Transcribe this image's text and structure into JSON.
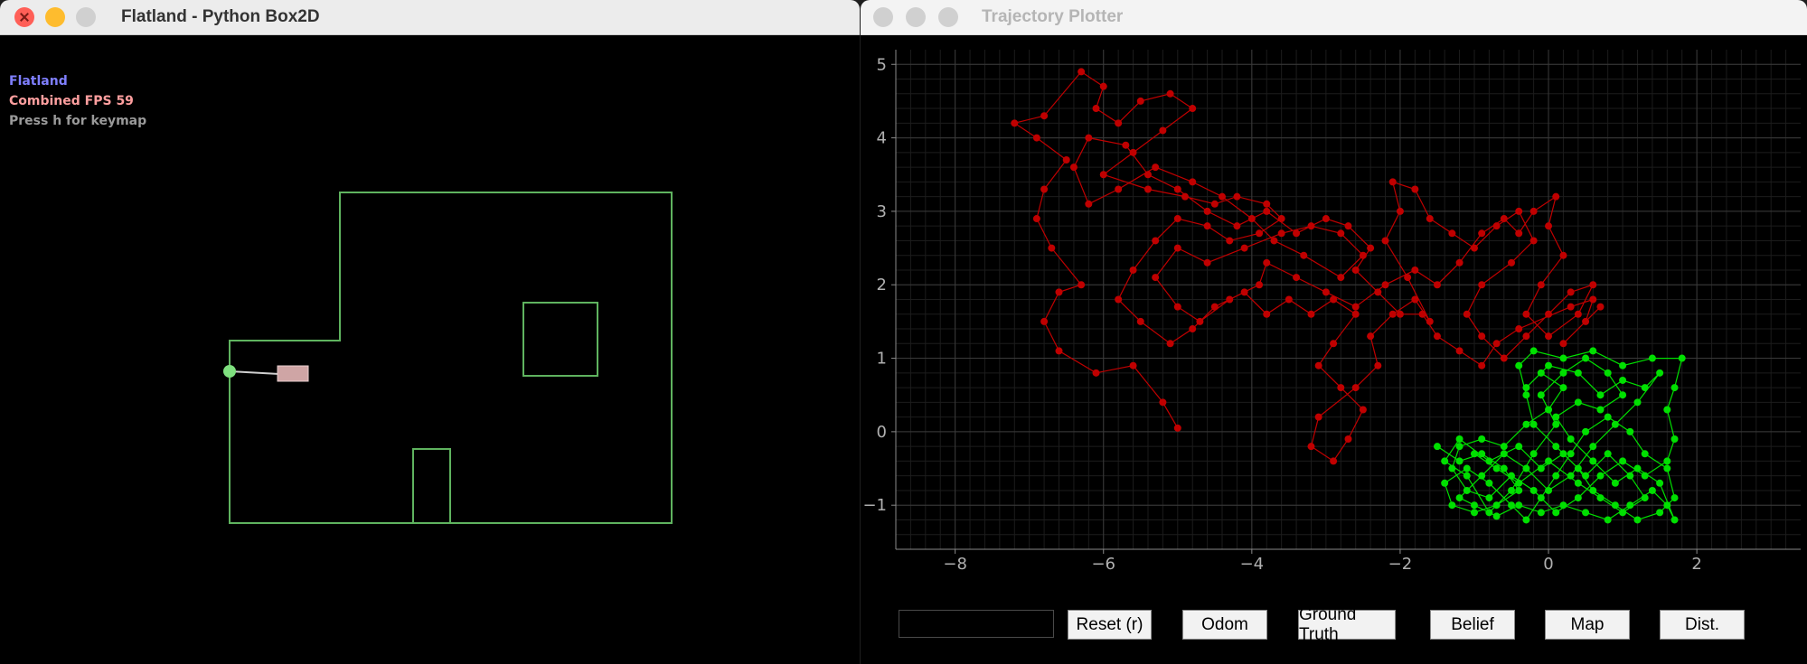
{
  "left_window": {
    "title": "Flatland - Python Box2D",
    "overlay": {
      "line1": "Flatland",
      "line2": "Combined FPS 59",
      "line3": "Press h for keymap"
    },
    "colors": {
      "walls": "#5fb35f",
      "robot_body": "#cfa5a5",
      "sensor_dot": "#7fe07f",
      "line1": "#7f7fff",
      "line2": "#ff9f9f",
      "line3": "#9a9a9a"
    }
  },
  "right_window": {
    "title": "Trajectory Plotter",
    "text_input_value": "",
    "buttons": {
      "reset": "Reset (r)",
      "odom": "Odom",
      "ground_truth": "Ground Truth",
      "belief": "Belief",
      "map": "Map",
      "dist": "Dist."
    }
  },
  "chart_data": {
    "type": "scatter",
    "xlim": [
      -8.8,
      3.4
    ],
    "ylim": [
      -1.6,
      5.2
    ],
    "x_ticks": [
      -8,
      -6,
      -4,
      -2,
      0,
      2
    ],
    "y_ticks": [
      -1,
      0,
      1,
      2,
      3,
      4,
      5
    ],
    "grid": true,
    "series": [
      {
        "color": "#c00000",
        "style": "line+markers",
        "points": [
          [
            -5.0,
            0.05
          ],
          [
            -5.2,
            0.4
          ],
          [
            -5.6,
            0.9
          ],
          [
            -6.1,
            0.8
          ],
          [
            -6.6,
            1.1
          ],
          [
            -6.8,
            1.5
          ],
          [
            -6.6,
            1.9
          ],
          [
            -6.3,
            2.0
          ],
          [
            -6.7,
            2.5
          ],
          [
            -6.9,
            2.9
          ],
          [
            -6.8,
            3.3
          ],
          [
            -6.5,
            3.7
          ],
          [
            -6.9,
            4.0
          ],
          [
            -7.2,
            4.2
          ],
          [
            -6.8,
            4.3
          ],
          [
            -6.3,
            4.9
          ],
          [
            -6.0,
            4.7
          ],
          [
            -6.1,
            4.4
          ],
          [
            -5.8,
            4.2
          ],
          [
            -5.5,
            4.5
          ],
          [
            -5.1,
            4.6
          ],
          [
            -4.8,
            4.4
          ],
          [
            -5.2,
            4.1
          ],
          [
            -5.6,
            3.8
          ],
          [
            -6.0,
            3.5
          ],
          [
            -5.4,
            3.3
          ],
          [
            -4.9,
            3.2
          ],
          [
            -4.5,
            3.1
          ],
          [
            -4.2,
            3.2
          ],
          [
            -3.8,
            3.1
          ],
          [
            -3.6,
            2.9
          ],
          [
            -3.9,
            2.7
          ],
          [
            -4.3,
            2.6
          ],
          [
            -4.6,
            2.8
          ],
          [
            -5.0,
            2.9
          ],
          [
            -5.3,
            2.6
          ],
          [
            -5.6,
            2.2
          ],
          [
            -5.8,
            1.8
          ],
          [
            -5.5,
            1.5
          ],
          [
            -5.1,
            1.2
          ],
          [
            -4.8,
            1.4
          ],
          [
            -4.5,
            1.7
          ],
          [
            -4.1,
            1.9
          ],
          [
            -3.8,
            1.6
          ],
          [
            -3.5,
            1.8
          ],
          [
            -3.2,
            1.6
          ],
          [
            -2.9,
            1.8
          ],
          [
            -2.6,
            1.6
          ],
          [
            -2.9,
            1.2
          ],
          [
            -3.1,
            0.9
          ],
          [
            -2.8,
            0.6
          ],
          [
            -2.5,
            0.3
          ],
          [
            -2.7,
            -0.1
          ],
          [
            -2.9,
            -0.4
          ],
          [
            -3.2,
            -0.2
          ],
          [
            -3.1,
            0.2
          ],
          [
            -2.6,
            0.6
          ],
          [
            -2.3,
            0.9
          ],
          [
            -2.4,
            1.3
          ],
          [
            -2.1,
            1.6
          ],
          [
            -1.8,
            1.8
          ],
          [
            -1.6,
            1.5
          ],
          [
            -1.9,
            2.1
          ],
          [
            -2.2,
            2.6
          ],
          [
            -2.0,
            3.0
          ],
          [
            -2.1,
            3.4
          ],
          [
            -1.8,
            3.3
          ],
          [
            -1.6,
            2.9
          ],
          [
            -1.3,
            2.7
          ],
          [
            -1.0,
            2.5
          ],
          [
            -0.7,
            2.8
          ],
          [
            -0.4,
            3.0
          ],
          [
            -0.2,
            2.6
          ],
          [
            -0.5,
            2.3
          ],
          [
            -0.9,
            2.0
          ],
          [
            -1.1,
            1.6
          ],
          [
            -0.9,
            1.3
          ],
          [
            -0.6,
            1.0
          ],
          [
            -0.3,
            1.3
          ],
          [
            0.0,
            1.6
          ],
          [
            0.3,
            1.9
          ],
          [
            0.6,
            2.0
          ],
          [
            0.4,
            1.6
          ],
          [
            0.0,
            1.3
          ],
          [
            -0.3,
            1.6
          ],
          [
            -0.1,
            2.0
          ],
          [
            0.2,
            2.4
          ],
          [
            0.0,
            2.8
          ],
          [
            0.1,
            3.2
          ],
          [
            -0.2,
            3.0
          ],
          [
            -0.4,
            2.7
          ],
          [
            -0.6,
            2.9
          ],
          [
            -0.9,
            2.7
          ],
          [
            -1.2,
            2.3
          ],
          [
            -1.5,
            2.0
          ],
          [
            -1.8,
            2.2
          ],
          [
            -2.2,
            2.0
          ],
          [
            -2.6,
            1.7
          ],
          [
            -3.0,
            1.9
          ],
          [
            -3.4,
            2.1
          ],
          [
            -3.8,
            2.3
          ],
          [
            -3.9,
            2.0
          ],
          [
            -4.3,
            1.8
          ],
          [
            -4.7,
            1.5
          ],
          [
            -5.0,
            1.7
          ],
          [
            -5.3,
            2.1
          ],
          [
            -5.0,
            2.5
          ],
          [
            -4.6,
            2.3
          ],
          [
            -4.1,
            2.5
          ],
          [
            -3.6,
            2.7
          ],
          [
            -3.2,
            2.8
          ],
          [
            -2.8,
            2.7
          ],
          [
            -2.5,
            2.4
          ],
          [
            -2.8,
            2.1
          ],
          [
            -3.3,
            2.4
          ],
          [
            -3.7,
            2.6
          ],
          [
            -4.0,
            2.9
          ],
          [
            -4.4,
            3.2
          ],
          [
            -4.8,
            3.4
          ],
          [
            -5.3,
            3.6
          ],
          [
            -5.8,
            3.3
          ],
          [
            -6.2,
            3.1
          ],
          [
            -6.4,
            3.6
          ],
          [
            -6.2,
            4.0
          ],
          [
            -5.7,
            3.9
          ],
          [
            -5.4,
            3.5
          ],
          [
            -5.0,
            3.3
          ],
          [
            -4.6,
            3.0
          ],
          [
            -4.2,
            2.8
          ],
          [
            -3.8,
            3.0
          ],
          [
            -3.4,
            2.7
          ],
          [
            -3.0,
            2.9
          ],
          [
            -2.7,
            2.8
          ],
          [
            -2.4,
            2.5
          ],
          [
            -2.6,
            2.2
          ],
          [
            -2.3,
            1.9
          ],
          [
            -2.0,
            1.6
          ],
          [
            -1.7,
            1.6
          ],
          [
            -1.5,
            1.3
          ],
          [
            -1.2,
            1.1
          ],
          [
            -0.9,
            0.9
          ],
          [
            -0.7,
            1.2
          ],
          [
            -0.4,
            1.4
          ],
          [
            0.3,
            1.7
          ],
          [
            0.6,
            1.8
          ],
          [
            0.5,
            1.5
          ],
          [
            0.7,
            1.7
          ],
          [
            0.2,
            1.2
          ]
        ]
      },
      {
        "color": "#00e000",
        "style": "line+markers",
        "points": [
          [
            -1.5,
            -0.2
          ],
          [
            -1.2,
            -0.4
          ],
          [
            -0.9,
            -0.3
          ],
          [
            -0.6,
            -0.5
          ],
          [
            -0.4,
            -0.8
          ],
          [
            -0.7,
            -1.0
          ],
          [
            -1.0,
            -1.1
          ],
          [
            -1.3,
            -1.0
          ],
          [
            -1.4,
            -0.7
          ],
          [
            -1.1,
            -0.5
          ],
          [
            -0.8,
            -0.7
          ],
          [
            -0.5,
            -1.0
          ],
          [
            -0.3,
            -1.2
          ],
          [
            -0.1,
            -0.9
          ],
          [
            0.1,
            -0.6
          ],
          [
            0.3,
            -0.3
          ],
          [
            0.5,
            0.0
          ],
          [
            0.8,
            0.2
          ],
          [
            1.1,
            0.0
          ],
          [
            1.3,
            -0.3
          ],
          [
            1.6,
            -0.5
          ],
          [
            1.7,
            -0.9
          ],
          [
            1.5,
            -1.1
          ],
          [
            1.2,
            -1.2
          ],
          [
            0.9,
            -1.0
          ],
          [
            0.6,
            -0.8
          ],
          [
            0.4,
            -0.5
          ],
          [
            0.1,
            -0.2
          ],
          [
            -0.2,
            0.1
          ],
          [
            -0.3,
            0.5
          ],
          [
            -0.4,
            0.9
          ],
          [
            -0.2,
            1.1
          ],
          [
            0.2,
            1.0
          ],
          [
            0.6,
            1.1
          ],
          [
            1.0,
            0.9
          ],
          [
            1.4,
            1.0
          ],
          [
            1.8,
            1.0
          ],
          [
            1.7,
            0.6
          ],
          [
            1.6,
            0.3
          ],
          [
            1.7,
            -0.1
          ],
          [
            1.6,
            -0.4
          ],
          [
            1.3,
            -0.6
          ],
          [
            1.0,
            -0.4
          ],
          [
            0.7,
            -0.6
          ],
          [
            0.4,
            -0.9
          ],
          [
            0.1,
            -1.1
          ],
          [
            -0.2,
            -0.8
          ],
          [
            -0.5,
            -0.6
          ],
          [
            -0.8,
            -0.9
          ],
          [
            -1.1,
            -0.8
          ],
          [
            -1.3,
            -0.5
          ],
          [
            -1.2,
            -0.2
          ],
          [
            -0.9,
            -0.1
          ],
          [
            -0.6,
            -0.2
          ],
          [
            -0.3,
            0.1
          ],
          [
            0.0,
            0.3
          ],
          [
            0.2,
            0.6
          ],
          [
            -0.1,
            0.8
          ],
          [
            -0.3,
            0.6
          ],
          [
            0.0,
            0.9
          ],
          [
            0.4,
            0.8
          ],
          [
            0.7,
            0.5
          ],
          [
            1.0,
            0.7
          ],
          [
            1.3,
            0.6
          ],
          [
            1.5,
            0.8
          ],
          [
            1.2,
            0.4
          ],
          [
            0.9,
            0.1
          ],
          [
            0.6,
            -0.2
          ],
          [
            0.3,
            -0.6
          ],
          [
            0.0,
            -0.8
          ],
          [
            -0.3,
            -0.5
          ],
          [
            -0.6,
            -0.3
          ],
          [
            -0.9,
            -0.6
          ],
          [
            -1.2,
            -0.9
          ],
          [
            -1.0,
            -1.0
          ],
          [
            -0.7,
            -1.15
          ],
          [
            -0.4,
            -1.0
          ],
          [
            -0.1,
            -1.1
          ],
          [
            0.2,
            -1.0
          ],
          [
            0.5,
            -1.1
          ],
          [
            0.8,
            -1.2
          ],
          [
            1.1,
            -1.0
          ],
          [
            1.4,
            -0.8
          ],
          [
            1.6,
            -1.0
          ],
          [
            1.7,
            -1.2
          ],
          [
            1.5,
            -0.7
          ],
          [
            1.2,
            -0.5
          ],
          [
            0.9,
            -0.7
          ],
          [
            0.6,
            -0.4
          ],
          [
            0.3,
            -0.1
          ],
          [
            0.1,
            0.2
          ],
          [
            0.4,
            0.4
          ],
          [
            0.7,
            0.3
          ],
          [
            1.0,
            0.5
          ],
          [
            0.8,
            0.8
          ],
          [
            0.5,
            1.0
          ],
          [
            0.2,
            0.8
          ],
          [
            -0.1,
            0.5
          ],
          [
            0.1,
            0.1
          ],
          [
            -0.2,
            -0.3
          ],
          [
            -0.5,
            -0.8
          ],
          [
            -0.8,
            -1.1
          ],
          [
            -1.1,
            -0.6
          ],
          [
            -1.4,
            -0.4
          ],
          [
            -1.2,
            -0.1
          ],
          [
            -0.8,
            -0.4
          ],
          [
            -0.4,
            -0.2
          ],
          [
            -0.1,
            -0.5
          ],
          [
            0.2,
            -0.3
          ],
          [
            0.5,
            -0.6
          ],
          [
            0.8,
            -0.3
          ],
          [
            1.1,
            -0.6
          ],
          [
            1.3,
            -0.9
          ],
          [
            1.0,
            -1.1
          ],
          [
            0.7,
            -0.9
          ],
          [
            0.4,
            -0.7
          ],
          [
            0.0,
            -0.4
          ],
          [
            -0.4,
            -0.7
          ],
          [
            -0.7,
            -0.5
          ],
          [
            -1.0,
            -0.3
          ]
        ]
      }
    ]
  }
}
